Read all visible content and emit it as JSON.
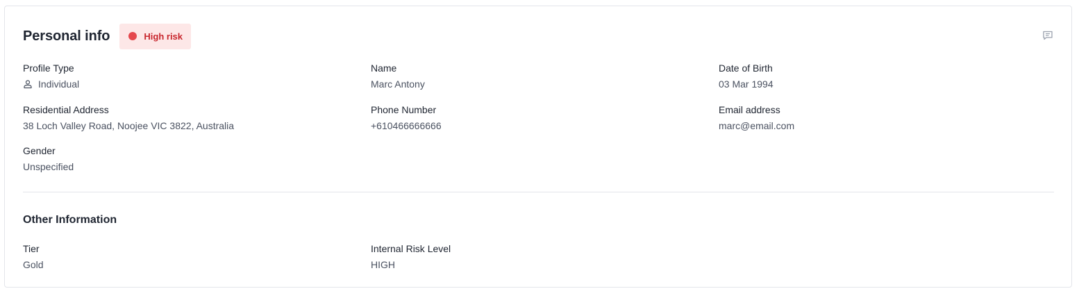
{
  "header": {
    "title": "Personal info",
    "risk_badge": {
      "label": "High risk",
      "dot_color": "#e5484d",
      "background": "#fde7e7",
      "text_color": "#c8262d"
    },
    "comment_icon": "comment-icon"
  },
  "personal": {
    "profile_type": {
      "label": "Profile Type",
      "value": "Individual",
      "icon": "person-icon"
    },
    "name": {
      "label": "Name",
      "value": "Marc Antony"
    },
    "dob": {
      "label": "Date of Birth",
      "value": "03 Mar 1994"
    },
    "address": {
      "label": "Residential Address",
      "value": "38 Loch Valley Road, Noojee VIC 3822, Australia"
    },
    "phone": {
      "label": "Phone Number",
      "value": "+610466666666"
    },
    "email": {
      "label": "Email address",
      "value": "marc@email.com"
    },
    "gender": {
      "label": "Gender",
      "value": "Unspecified"
    }
  },
  "other": {
    "title": "Other Information",
    "tier": {
      "label": "Tier",
      "value": "Gold"
    },
    "internal_risk": {
      "label": "Internal Risk Level",
      "value": "HIGH"
    }
  }
}
